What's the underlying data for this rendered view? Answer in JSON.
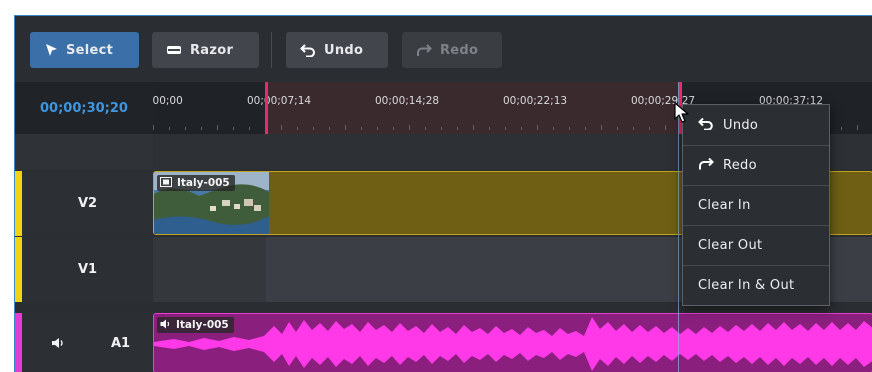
{
  "toolbar": {
    "select_label": "Select",
    "razor_label": "Razor",
    "undo_label": "Undo",
    "redo_label": "Redo"
  },
  "timeline": {
    "current_timecode": "00;00;30;20",
    "ruler_labels": [
      ":00;00",
      "00;00;07;14",
      "00;00;14;28",
      "00;00;22;13",
      "00;00;29;27",
      "00;00;37;12"
    ]
  },
  "tracks": {
    "v2": {
      "label": "V2",
      "color": "#f0d312"
    },
    "v1": {
      "label": "V1",
      "color": "#f0d312"
    },
    "a1": {
      "label": "A1",
      "color": "#e63ad6"
    }
  },
  "clips": {
    "video": {
      "name": "Italy-005",
      "icon": "film-icon"
    },
    "audio": {
      "name": "Italy-005",
      "icon": "speaker-icon"
    }
  },
  "context_menu": {
    "undo": "Undo",
    "redo": "Redo",
    "clear_in": "Clear In",
    "clear_out": "Clear Out",
    "clear_in_out": "Clear In & Out"
  },
  "colors": {
    "accent": "#3a6fa7",
    "timecode": "#3d97e0",
    "in_out_marker": "#f0276d",
    "video_clip": "#6e5f14",
    "audio_clip": "#e43fd2"
  }
}
